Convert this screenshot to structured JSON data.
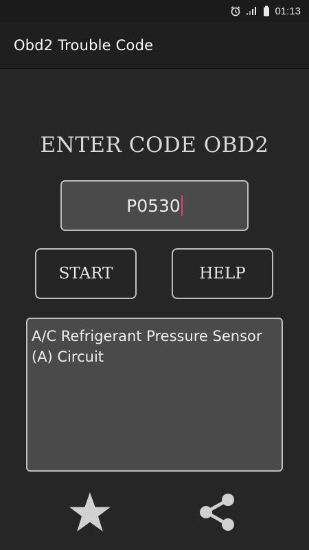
{
  "status_bar": {
    "time": "01:13",
    "icons": [
      "alarm-icon",
      "signal-icon",
      "battery-icon"
    ]
  },
  "app_bar": {
    "title": "Obd2 Trouble Code"
  },
  "main": {
    "heading": "ENTER CODE OBD2",
    "code_input": {
      "value": "P0530"
    },
    "start_label": "START",
    "help_label": "HELP",
    "result_text": "A/C Refrigerant Pressure Sensor (A) Circuit"
  },
  "actions": {
    "favorite_icon": "star-icon",
    "share_icon": "share-icon"
  },
  "colors": {
    "background": "#262626",
    "app_bar": "#1f1f1f",
    "field": "#4a4a4a",
    "border": "#bdbdbd",
    "caret": "#e0406a",
    "icon": "#d0d0d0"
  }
}
